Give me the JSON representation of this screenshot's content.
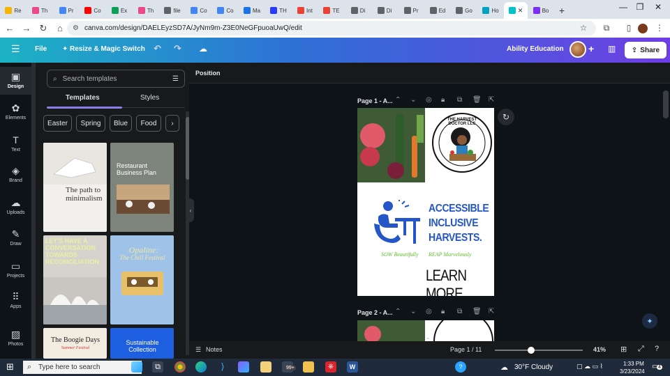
{
  "browser": {
    "tabs": [
      {
        "label": "Re",
        "color": "#f4b400"
      },
      {
        "label": "Th",
        "color": "#e94b8a"
      },
      {
        "label": "Pr",
        "color": "#4285f4"
      },
      {
        "label": "Co",
        "color": "#ff0000"
      },
      {
        "label": "Ex",
        "color": "#0f9d58"
      },
      {
        "label": "Th",
        "color": "#e94b8a"
      },
      {
        "label": "file",
        "color": "#5f6368"
      },
      {
        "label": "Co",
        "color": "#4285f4"
      },
      {
        "label": "Co",
        "color": "#4285f4"
      },
      {
        "label": "Ma",
        "color": "#1a73e8"
      },
      {
        "label": "TH",
        "color": "#2a3cff"
      },
      {
        "label": "Int",
        "color": "#ea4335"
      },
      {
        "label": "TE",
        "color": "#ea4335"
      },
      {
        "label": "Di",
        "color": "#5f6368"
      },
      {
        "label": "Di",
        "color": "#5f6368"
      },
      {
        "label": "Pr",
        "color": "#5f6368"
      },
      {
        "label": "Ed",
        "color": "#5f6368"
      },
      {
        "label": "Go",
        "color": "#5f6368"
      },
      {
        "label": "Ho",
        "color": "#00a3bf"
      },
      {
        "label": "",
        "color": "#00c4cc"
      },
      {
        "label": "Bo",
        "color": "#7b2ff7"
      }
    ],
    "active_tab_close": "✕",
    "new_tab": "+",
    "url": "canva.com/design/DAELEyzSD7A/JyNm9m-Z3E0NeGFpuoaUwQ/edit"
  },
  "header": {
    "menu_icon": "☰",
    "file": "File",
    "resize": "Resize & Magic Switch",
    "team": "Ability Education",
    "plus": "+",
    "share": "Share"
  },
  "rail": [
    {
      "icon": "▣",
      "label": "Design"
    },
    {
      "icon": "✿",
      "label": "Elements"
    },
    {
      "icon": "T",
      "label": "Text"
    },
    {
      "icon": "◈",
      "label": "Brand"
    },
    {
      "icon": "☁",
      "label": "Uploads"
    },
    {
      "icon": "✎",
      "label": "Draw"
    },
    {
      "icon": "▭",
      "label": "Projects"
    },
    {
      "icon": "⠿",
      "label": "Apps"
    },
    {
      "icon": "▨",
      "label": "Photos"
    }
  ],
  "panel": {
    "search_placeholder": "Search templates",
    "tab_templates": "Templates",
    "tab_styles": "Styles",
    "chips": [
      "Easter",
      "Spring",
      "Blue",
      "Food"
    ],
    "thumbs": {
      "minimalism": "The path to minimalism",
      "restaurant": "Restaurant Business Plan",
      "conversation": "LET'S HAVE A CONVERSATION TOWARDS RECONCILIATION",
      "opaline_title": "Opaline:",
      "opaline_sub": "The Chill Festival",
      "boogie": "The Boogie Days",
      "boogie_sub": "Summer Festival",
      "sustainable": "Sustainable Collection"
    }
  },
  "workspace": {
    "toolbar_label": "Position",
    "page1_label": "Page 1 - A...",
    "page2_label": "Page 2 - A...",
    "design": {
      "logo_text": "THE HARVEST DOCTOR LLC",
      "headline": [
        "ACCESSIBLE",
        "INCLUSIVE",
        "HARVESTS."
      ],
      "tagline_left": "SOW Beautifully",
      "tagline_right": "REAP Marvelously",
      "cta": "LEARN MORE"
    }
  },
  "bottombar": {
    "notes": "Notes",
    "page_count": "Page 1 / 11",
    "zoom": "41%",
    "zoom_fraction": 0.41
  },
  "taskbar": {
    "search_placeholder": "Type here to search",
    "weather": "30°F  Cloudy",
    "time": "1:33 PM",
    "date": "3/23/2024",
    "badge": "99+",
    "notif": "4"
  }
}
